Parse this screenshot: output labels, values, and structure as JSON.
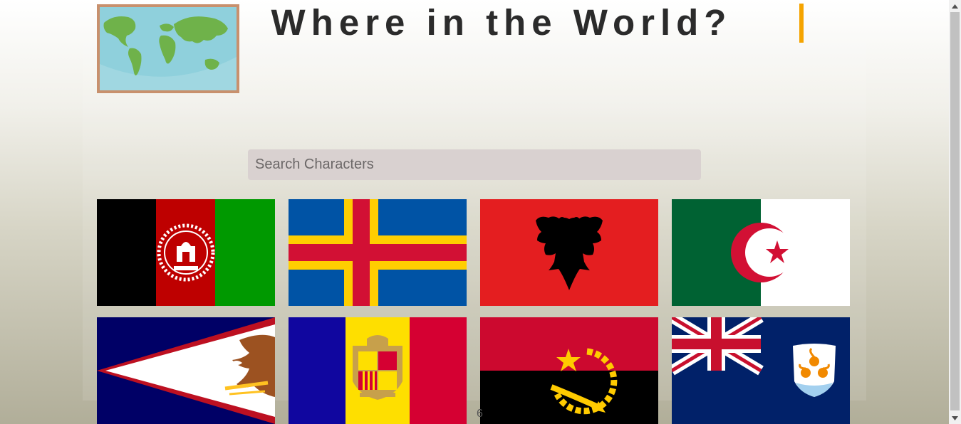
{
  "header": {
    "title": "Where in the World?",
    "accent_color": "#f5a400",
    "logo_icon": "world-map-icon"
  },
  "search": {
    "placeholder": "Search Characters",
    "value": ""
  },
  "flags": [
    {
      "country": "afghanistan",
      "icon": "afghanistan-flag-icon"
    },
    {
      "country": "aland-islands",
      "icon": "aland-flag-icon"
    },
    {
      "country": "albania",
      "icon": "albania-flag-icon"
    },
    {
      "country": "algeria",
      "icon": "algeria-flag-icon"
    },
    {
      "country": "american-samoa",
      "icon": "american-samoa-flag-icon"
    },
    {
      "country": "andorra",
      "icon": "andorra-flag-icon"
    },
    {
      "country": "angola",
      "icon": "angola-flag-icon"
    },
    {
      "country": "anguilla",
      "icon": "anguilla-flag-icon"
    }
  ],
  "footer": {
    "text": "6"
  },
  "scrollbar": {
    "up_icon": "scroll-up-arrow-icon",
    "down_icon": "scroll-down-arrow-icon"
  }
}
